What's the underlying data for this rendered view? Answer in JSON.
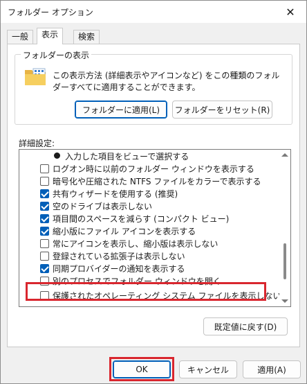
{
  "window": {
    "title": "フォルダー オプション",
    "close_glyph": "✕"
  },
  "tabs": [
    {
      "label": "一般",
      "active": false
    },
    {
      "label": "表示",
      "active": true
    },
    {
      "label": "検索",
      "active": false
    }
  ],
  "folder_view": {
    "group_label": "フォルダーの表示",
    "description": "この表示方法 (詳細表示やアイコンなど) をこの種類のフォルダーすべてに適用することができます。",
    "apply_button": "フォルダーに適用(L)",
    "reset_button": "フォルダーをリセット(R)"
  },
  "advanced": {
    "label": "詳細設定:",
    "items": [
      {
        "type": "radio",
        "checked": true,
        "label": "入力した項目をビューで選択する"
      },
      {
        "type": "checkbox",
        "checked": false,
        "label": "ログオン時に以前のフォルダー ウィンドウを表示する"
      },
      {
        "type": "checkbox",
        "checked": false,
        "label": "暗号化や圧縮された NTFS ファイルをカラーで表示する"
      },
      {
        "type": "checkbox",
        "checked": true,
        "label": "共有ウィザードを使用する (推奨)"
      },
      {
        "type": "checkbox",
        "checked": true,
        "label": "空のドライブは表示しない"
      },
      {
        "type": "checkbox",
        "checked": true,
        "label": "項目間のスペースを減らす (コンパクト ビュー)"
      },
      {
        "type": "checkbox",
        "checked": true,
        "label": "縮小版にファイル アイコンを表示する"
      },
      {
        "type": "checkbox",
        "checked": false,
        "label": "常にアイコンを表示し、縮小版は表示しない"
      },
      {
        "type": "checkbox",
        "checked": false,
        "label": "登録されている拡張子は表示しない"
      },
      {
        "type": "checkbox",
        "checked": true,
        "label": "同期プロバイダーの通知を表示する"
      },
      {
        "type": "checkbox",
        "checked": false,
        "label": "別のプロセスでフォルダー ウィンドウを開く"
      },
      {
        "type": "checkbox",
        "checked": false,
        "label": "保護されたオペレーティング システム ファイルを表示しない (推奨)"
      }
    ],
    "defaults_button": "既定値に戻す(D)"
  },
  "footer": {
    "ok": "OK",
    "cancel": "キャンセル",
    "apply": "適用(A)"
  },
  "colors": {
    "accent": "#005fb8",
    "highlight": "#d9262e"
  }
}
